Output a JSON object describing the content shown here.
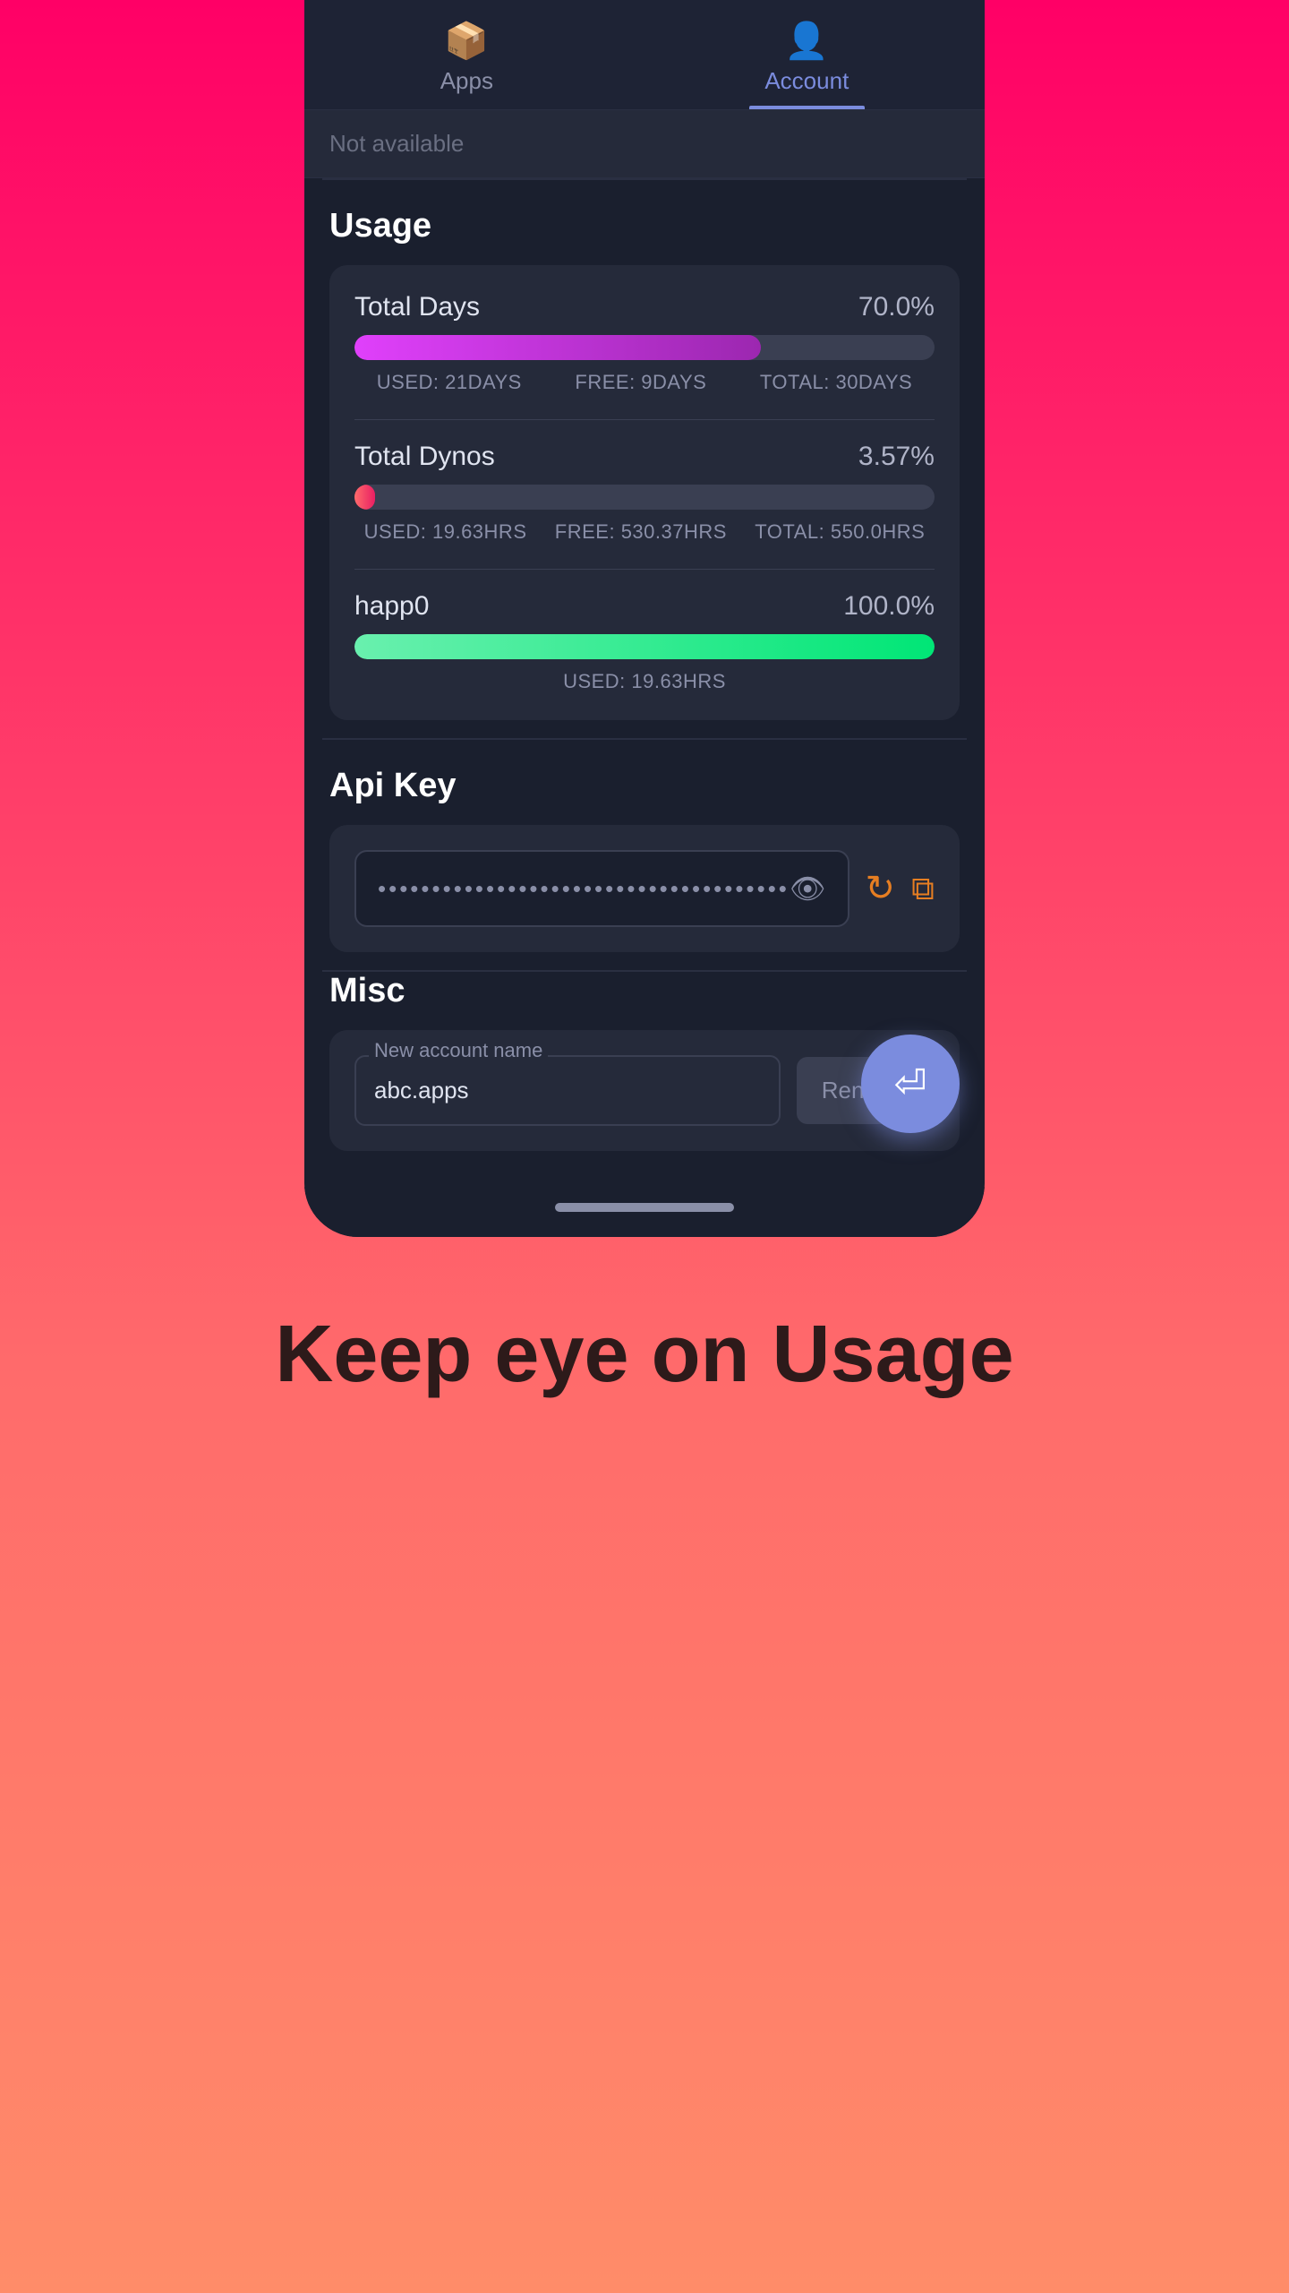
{
  "tabs": [
    {
      "id": "apps",
      "label": "Apps",
      "icon": "📦",
      "active": false
    },
    {
      "id": "account",
      "label": "Account",
      "icon": "👤",
      "active": true
    }
  ],
  "not_available": {
    "text": "Not available"
  },
  "usage": {
    "title": "Usage",
    "items": [
      {
        "name": "Total Days",
        "percent": "70.0%",
        "fill_width": "70%",
        "fill_class": "fill-pink",
        "stats": [
          "USED: 21DAYS",
          "FREE: 9DAYS",
          "TOTAL: 30DAYS"
        ]
      },
      {
        "name": "Total Dynos",
        "percent": "3.57%",
        "fill_width": "3.57%",
        "fill_class": "fill-salmon",
        "stats": [
          "USED: 19.63HRS",
          "FREE: 530.37HRS",
          "TOTAL: 550.0HRS"
        ]
      },
      {
        "name": "happ0",
        "percent": "100.0%",
        "fill_width": "100%",
        "fill_class": "fill-green",
        "stats": [
          "USED: 19.63HRS"
        ]
      }
    ]
  },
  "api_key": {
    "title": "Api Key",
    "value": "••••••••••••••••••••••••••••••••••••••",
    "eye_icon": "👁",
    "refresh_icon": "↻",
    "copy_icon": "⧉"
  },
  "misc": {
    "title": "Misc",
    "input_label": "New account name",
    "input_value": "abc.apps",
    "rename_label": "Rename",
    "logout_icon": "⏎"
  },
  "bottom_caption": "Keep eye on Usage",
  "nav_handle": true
}
